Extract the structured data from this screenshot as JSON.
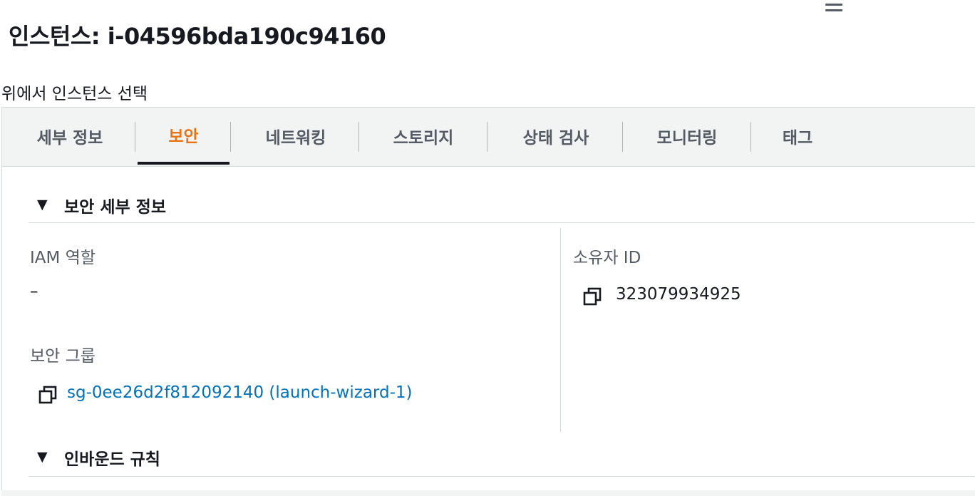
{
  "page": {
    "title": "인스턴스: i-04596bda190c94160",
    "subtitle": "위에서 인스턴스 선택"
  },
  "tabs": [
    {
      "label": "세부 정보",
      "active": false
    },
    {
      "label": "보안",
      "active": true
    },
    {
      "label": "네트워킹",
      "active": false
    },
    {
      "label": "스토리지",
      "active": false
    },
    {
      "label": "상태 검사",
      "active": false
    },
    {
      "label": "모니터링",
      "active": false
    },
    {
      "label": "태그",
      "active": false
    }
  ],
  "security_details": {
    "header": "보안 세부 정보",
    "iam_role": {
      "label": "IAM 역할",
      "value": "–"
    },
    "owner_id": {
      "label": "소유자 ID",
      "value": "323079934925"
    },
    "security_groups": {
      "label": "보안 그룹",
      "value": "sg-0ee26d2f812092140 (launch-wizard-1)"
    }
  },
  "inbound_rules": {
    "header": "인바운드 규칙"
  },
  "icons": {
    "drag_handle": "drag-handle-icon",
    "caret": "caret-down-icon",
    "copy": "copy-icon"
  },
  "colors": {
    "active_tab": "#ec7211",
    "link": "#0073bb",
    "text": "#16191f",
    "muted_text": "#545b64"
  }
}
